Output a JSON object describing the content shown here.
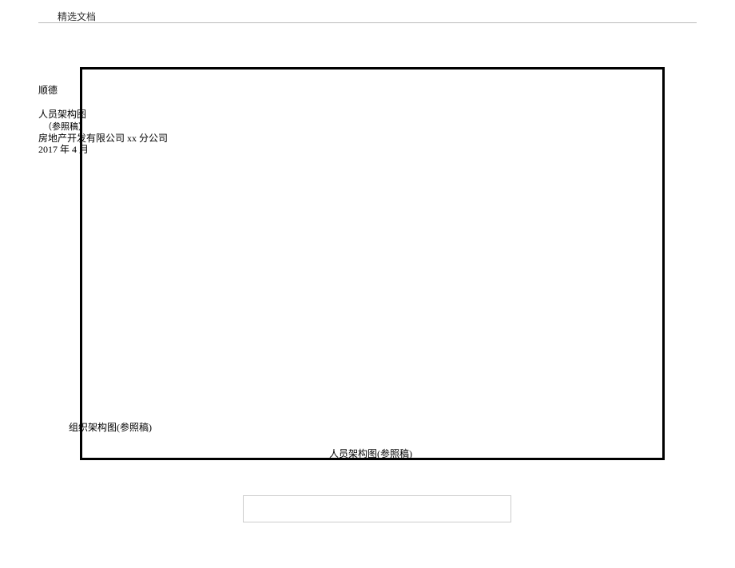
{
  "header": {
    "label": "精选文档"
  },
  "content": {
    "shunde": "顺德",
    "title": "人员架构图",
    "subtitle": "（参照稿）",
    "company": "房地产开发有限公司 xx 分公司",
    "date": "2017 年 4 月",
    "orgchart": "组织架构图(参照稿)",
    "bottomTitle": "人员架构图(参照稿)"
  }
}
